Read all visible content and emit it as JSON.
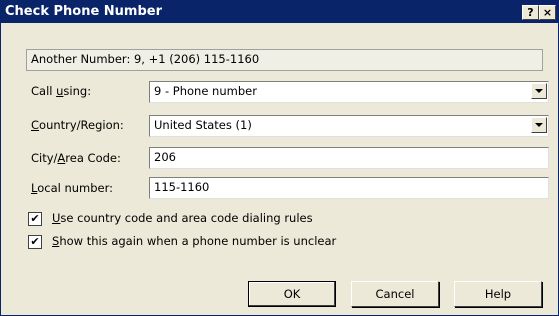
{
  "window": {
    "title": "Check Phone Number",
    "help_glyph": "?",
    "close_glyph": "×"
  },
  "number_display": "Another Number: 9, +1 (206) 115-1160",
  "form": {
    "call_using": {
      "label_pre": "Call ",
      "label_u": "u",
      "label_post": "sing:",
      "value": "9 - Phone number"
    },
    "country": {
      "label_pre": "",
      "label_u": "C",
      "label_post": "ountry/Region:",
      "value": "United States (1)"
    },
    "city": {
      "label_pre": "City/",
      "label_u": "A",
      "label_post": "rea Code:",
      "value": "206"
    },
    "local": {
      "label_pre": "",
      "label_u": "L",
      "label_post": "ocal number:",
      "value": "115-1160"
    }
  },
  "checkboxes": [
    {
      "pre": "",
      "u": "U",
      "post": "se country code and area code dialing rules",
      "checked": true
    },
    {
      "pre": "",
      "u": "S",
      "post": "how this again when a phone number is unclear",
      "checked": true
    }
  ],
  "buttons": {
    "ok": "OK",
    "cancel": "Cancel",
    "help": "Help"
  },
  "check_glyph": "✔",
  "colors": {
    "title_bar": "#0a246a",
    "dialog_bg": "#ece9d8"
  }
}
